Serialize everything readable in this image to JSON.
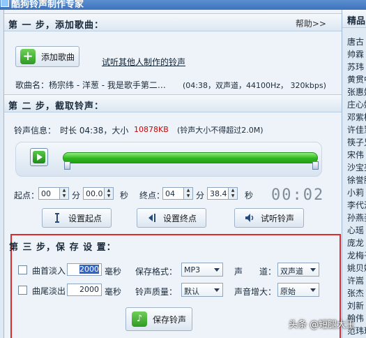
{
  "window": {
    "title": "酷狗铃声制作专家"
  },
  "step1": {
    "title": "第 一 步，添加歌曲：",
    "help": "帮助>>",
    "add_button": "添加歌曲",
    "others_link": "试听其他人制作的铃声",
    "song_label": "歌曲名：",
    "song_name": "杨宗纬 - 洋葱 - 我是歌手第二…",
    "song_meta": "(04:38，双声道，44100Hz， 320kbps)"
  },
  "step2": {
    "title": "第 二 步，截取铃声：",
    "info_label": "铃声信息：",
    "info_duration": "时长 04:38，大小",
    "info_size": "10878KB",
    "info_limit": "(铃声大小不得超过2.0M)",
    "start_label": "起点：",
    "start_min": "00",
    "min_unit": "分",
    "start_sec": "00.0",
    "sec_unit": "秒",
    "end_label": "终点：",
    "end_min": "04",
    "end_sec": "38.4",
    "timer": "00:02",
    "set_start": "设置起点",
    "set_end": "设置终点",
    "preview": "试听铃声"
  },
  "step3": {
    "title": "第 三 步，保 存 设 置：",
    "fadein_label": "曲首淡入",
    "fadein_value": "2000",
    "fadeout_label": "曲尾淡出",
    "fadeout_value": "2000",
    "ms_unit": "毫秒",
    "format_label": "保存格式：",
    "format_value": "MP3",
    "quality_label": "铃声质量：",
    "quality_value": "默认",
    "channel_label": "声　　道：",
    "channel_value": "双声道",
    "gain_label": "声音增大：",
    "gain_value": "原始",
    "save_button": "保存铃声"
  },
  "right_panel": {
    "title": "精品",
    "items": [
      "唐古",
      "帅霖",
      "苏玮",
      "黄贯中",
      "张惠妹",
      "庄心妍",
      "邓紫棋",
      "许佳慧",
      "筷子兄",
      "宋伟",
      "沙宝亮",
      "徐誉滕",
      "小莉",
      "李代沫",
      "孙燕姿",
      "心瑶",
      "庞龙",
      "龙梅子",
      "姚贝娜",
      "许嵩",
      "张杰",
      "刘新",
      "翰伟",
      "范玮琪"
    ]
  },
  "watermark": "头条 @短腿大王"
}
